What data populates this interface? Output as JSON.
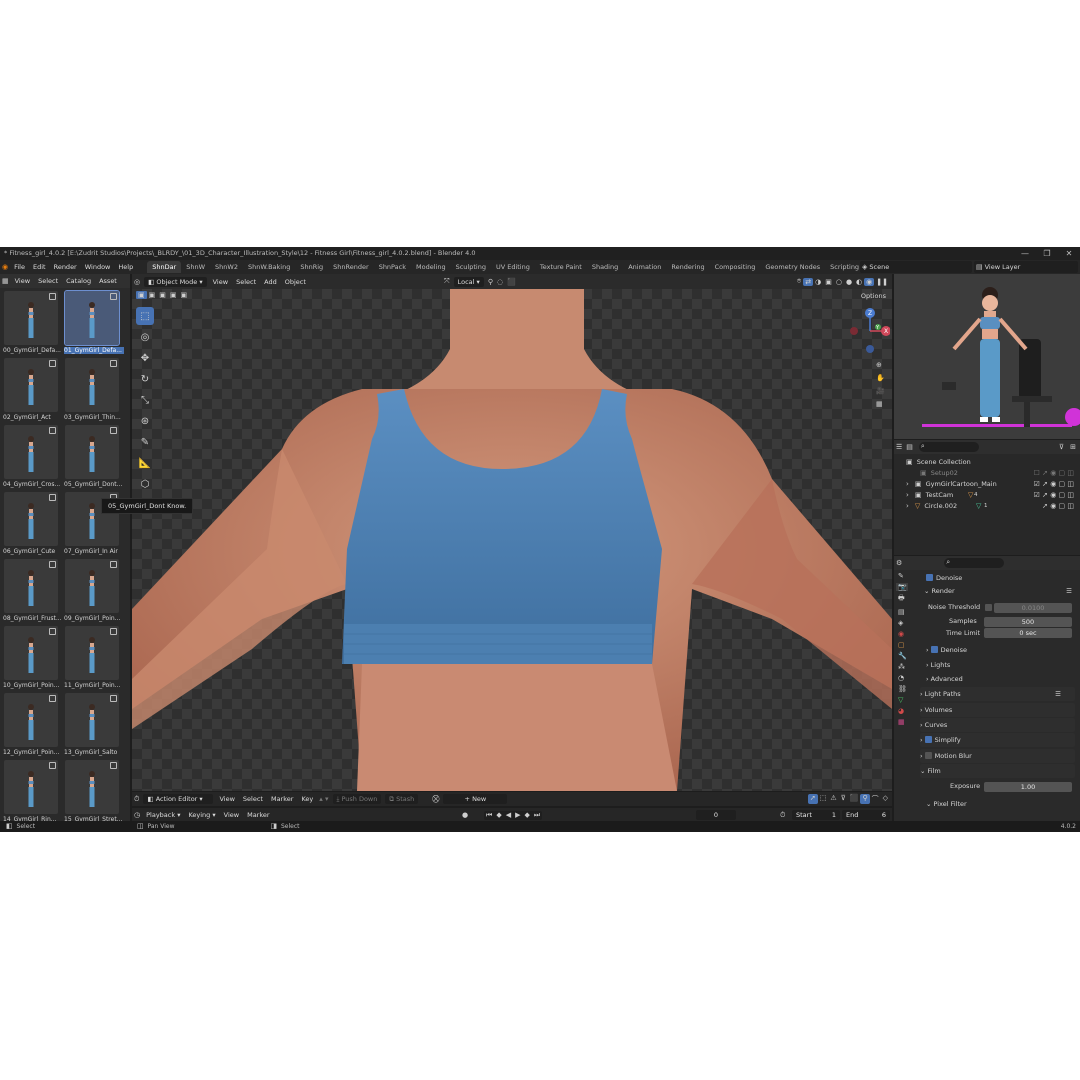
{
  "window": {
    "title": "* Fitness_girl_4.0.2 [E:\\Zudrit Studios\\Projects\\_BLRDY_\\01_3D_Character_Illustration_Style\\12 - Fitness Girl\\Fitness_girl_4.0.2.blend] - Blender 4.0",
    "controls": [
      "—",
      "❐",
      "✕"
    ]
  },
  "menu": [
    "File",
    "Edit",
    "Render",
    "Window",
    "Help"
  ],
  "workspaces": [
    "ShnDar",
    "ShnW",
    "ShnW2",
    "ShnW.Baking",
    "ShnRig",
    "ShnRender",
    "ShnPack",
    "Modeling",
    "Sculpting",
    "UV Editing",
    "Texture Paint",
    "Shading",
    "Animation",
    "Rendering",
    "Compositing",
    "Geometry Nodes",
    "Scripting",
    "+"
  ],
  "scene": {
    "name": "Scene",
    "view_layer": "View Layer"
  },
  "asset_browser": {
    "menu": [
      "View",
      "Select",
      "Catalog",
      "Asset"
    ],
    "assets": [
      "00_GymGirl_Defa...",
      "01_GymGirl_Defa...",
      "02_GymGirl_Act",
      "03_GymGirl_Thin...",
      "04_GymGirl_Cros...",
      "05_GymGirl_Dont...",
      "06_GymGirl_Cute",
      "07_GymGirl_In Air",
      "08_GymGirl_Frust...",
      "09_GymGirl_Poin...",
      "10_GymGirl_Poin...",
      "11_GymGirl_Poin...",
      "12_GymGirl_Poin...",
      "13_GymGirl_Salto",
      "14_GymGirl_Rin...",
      "15_GymGirl_Stret..."
    ],
    "selected_index": 1,
    "tooltip": "05_GymGirl_Dont Know."
  },
  "viewport": {
    "mode": "Object Mode",
    "menu": [
      "View",
      "Select",
      "Add",
      "Object"
    ],
    "orientation": "Local",
    "options_label": "Options",
    "gizmo_axes": [
      "Z",
      "X",
      "Y"
    ]
  },
  "outliner": {
    "search_placeholder": "",
    "rows": [
      {
        "label": "Scene Collection"
      },
      {
        "label": "Setup02"
      },
      {
        "label": "GymGirlCartoon_Main"
      },
      {
        "label": "TestCam",
        "badge": "4"
      },
      {
        "label": "Circle.002",
        "badge": "1"
      }
    ]
  },
  "properties": {
    "denoise1": "Denoise",
    "render": "Render",
    "noise_threshold": {
      "label": "Noise Threshold",
      "value": "0.0100"
    },
    "samples": {
      "label": "Samples",
      "value": "500"
    },
    "time_limit": {
      "label": "Time Limit",
      "value": "0 sec"
    },
    "denoise2": "Denoise",
    "lights": "Lights",
    "advanced": "Advanced",
    "light_paths": "Light Paths",
    "volumes": "Volumes",
    "curves": "Curves",
    "simplify": "Simplify",
    "motion_blur": "Motion Blur",
    "film": "Film",
    "exposure": {
      "label": "Exposure",
      "value": "1.00"
    },
    "pixel_filter": "Pixel Filter"
  },
  "action_editor": {
    "mode": "Action Editor",
    "menu": [
      "View",
      "Select",
      "Marker",
      "Key"
    ],
    "push_down": "Push Down",
    "stash": "Stash",
    "new": "New"
  },
  "timeline": {
    "menu": [
      "Playback",
      "Keying",
      "View",
      "Marker"
    ],
    "current_frame": "0",
    "start_label": "Start",
    "start": "1",
    "end_label": "End",
    "end": "6"
  },
  "status_bar": {
    "left1": "Select",
    "left2": "Pan View",
    "left3": "Select",
    "version": "4.0.2"
  },
  "colors": {
    "accent": "#4772b3",
    "top": "#5a8fc0",
    "skin": "#d49a7e"
  }
}
